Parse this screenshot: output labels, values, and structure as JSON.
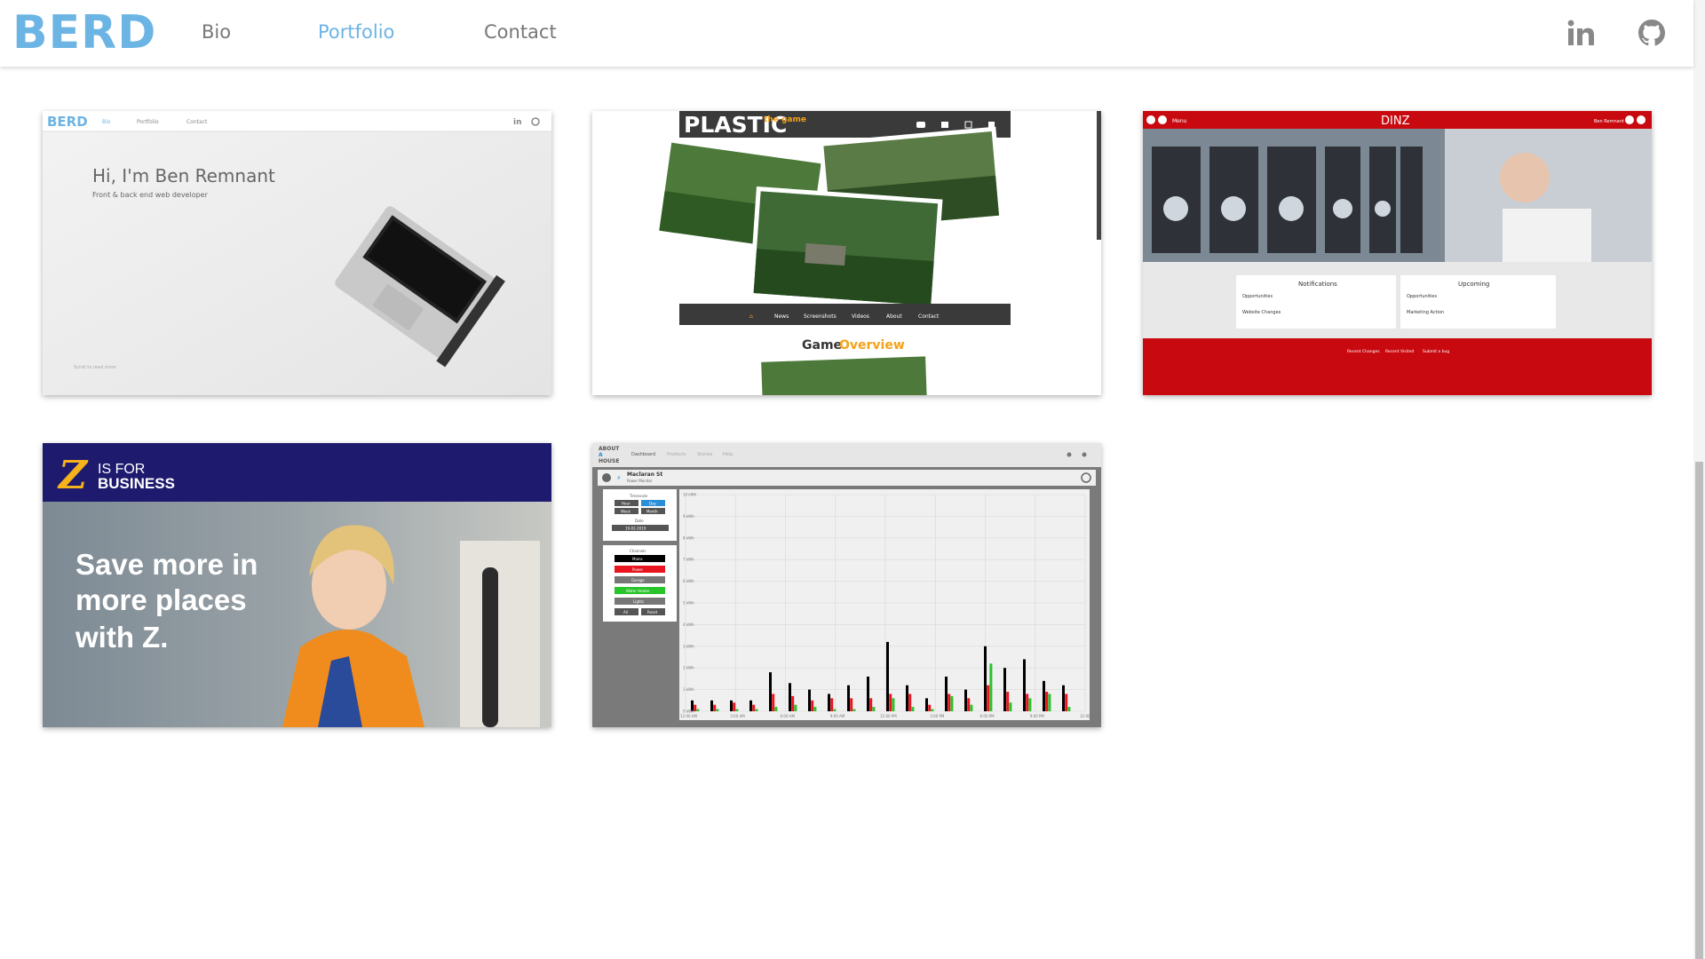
{
  "header": {
    "logo": "BERD",
    "nav": [
      {
        "label": "Bio"
      },
      {
        "label": "Portfolio"
      },
      {
        "label": "Contact"
      }
    ],
    "social": [
      {
        "icon": "linkedin-icon"
      },
      {
        "icon": "github-icon"
      }
    ],
    "accent": "#6cb4e4"
  },
  "portfolio": [
    {
      "logo": "BERD",
      "nav": [
        "Bio",
        "Portfolio",
        "Contact"
      ],
      "headline": "Hi, I'm Ben Remnant",
      "sub": "Front & back end web developer",
      "footer": "Scroll to read more"
    },
    {
      "brand": "PLASTIC",
      "tag": "the game",
      "nav": [
        "News",
        "Screenshots",
        "Videos",
        "About",
        "Contact"
      ],
      "title_a": "Game",
      "title_b": "Overview"
    },
    {
      "menu": "Menu",
      "brand": "DINZ",
      "user": "Ben Remnant",
      "panels": [
        {
          "title": "Notifications",
          "rows": [
            "Opportunities",
            "Website Changes"
          ]
        },
        {
          "title": "Upcoming",
          "rows": [
            "Opportunities",
            "Marketing Action"
          ]
        }
      ],
      "buttons": [
        "Recent Changes",
        "Recent Visited",
        "Submit a bug"
      ]
    },
    {
      "brand_top": "IS FOR",
      "brand_bottom": "BUSINESS",
      "headline": [
        "Save more in",
        "more places",
        "with Z."
      ]
    },
    {
      "brand": [
        "ABOUT",
        "A",
        "HOUSE"
      ],
      "nav": [
        "Dashboard",
        "Products",
        "Stories",
        "Help"
      ],
      "location": "Maclaran St",
      "sublocation": "Power Monitor",
      "timescale": "Timescale",
      "scale_buttons": [
        "Hour",
        "Day",
        "Week",
        "Month"
      ],
      "date_label": "Date",
      "date": "19-02-2019",
      "channels_label": "Channels",
      "channels": [
        "Mains",
        "Power",
        "Garage",
        "Water Heater",
        "Lights",
        "All",
        "Reset"
      ],
      "y_labels": [
        "10 kWh",
        "9 kWh",
        "8 kWh",
        "7 kWh",
        "6 kWh",
        "5 kWh",
        "4 kWh",
        "3 kWh",
        "2 kWh",
        "1 kWh",
        "0 kWh"
      ],
      "x_labels": [
        "12:00 AM",
        "3:00 AM",
        "6:00 AM",
        "9:00 AM",
        "12:00 PM",
        "3:00 PM",
        "6:00 PM",
        "9:00 PM",
        "12:00 AM"
      ],
      "chart_data": {
        "type": "bar",
        "ylabel": "",
        "ylim": [
          0,
          10
        ],
        "series": [
          {
            "values": [
              0.5,
              0.5,
              0.5,
              0.5,
              1.8,
              1.3,
              1.0,
              0.8,
              1.2,
              1.6,
              3.2,
              1.2,
              0.6,
              1.6,
              1.0,
              3.0,
              2.0,
              2.4,
              1.4,
              1.2
            ]
          },
          {
            "values": [
              0.3,
              0.3,
              0.4,
              0.3,
              0.8,
              0.7,
              0.5,
              0.6,
              0.6,
              0.6,
              0.8,
              0.8,
              0.3,
              0.8,
              0.6,
              1.2,
              0.9,
              0.8,
              0.9,
              0.8
            ]
          },
          {
            "values": [
              0.1,
              0.1,
              0.1,
              0.1,
              0.2,
              0.3,
              0.2,
              0.1,
              0.1,
              0.2,
              0.6,
              0.2,
              0.1,
              0.7,
              0.3,
              2.2,
              0.4,
              0.6,
              0.8,
              0.2
            ]
          }
        ],
        "colors": [
          "#000000",
          "#e8141e",
          "#27c42a"
        ]
      }
    }
  ]
}
